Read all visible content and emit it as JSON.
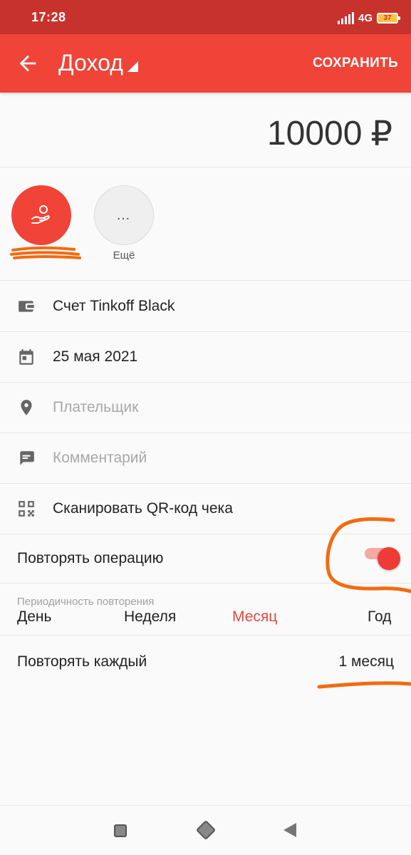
{
  "status": {
    "time": "17:28",
    "network": "4G",
    "battery": "37"
  },
  "appbar": {
    "title": "Доход",
    "save_label": "СОХРАНИТЬ"
  },
  "amount": {
    "value": "10000",
    "currency": "₽"
  },
  "categories": {
    "more_dots": "…",
    "more_label": "Ещё"
  },
  "fields": {
    "account": "Счет Tinkoff Black",
    "date": "25 мая 2021",
    "payer_placeholder": "Плательщик",
    "comment_placeholder": "Комментарий",
    "scan_qr": "Сканировать QR-код чека"
  },
  "repeat": {
    "label": "Повторять операцию",
    "enabled": true,
    "period_caption": "Периодичность повторения",
    "options": [
      "День",
      "Неделя",
      "Месяц",
      "Год"
    ],
    "selected": "Месяц",
    "every_label": "Повторять каждый",
    "every_value": "1 месяц"
  },
  "colors": {
    "accent": "#ef4437",
    "status_bar": "#c8322c",
    "annotation": "#f26b12"
  }
}
